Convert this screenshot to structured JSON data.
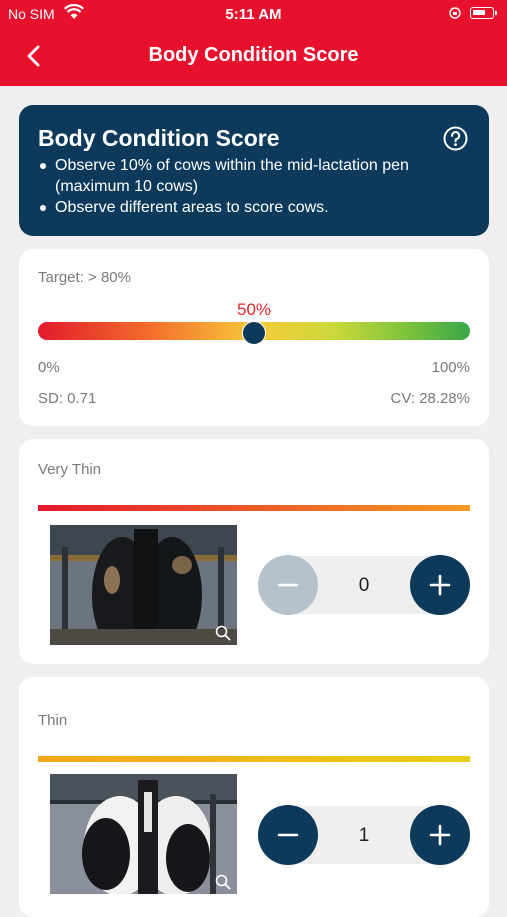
{
  "status": {
    "carrier": "No SIM",
    "time": "5:11 AM"
  },
  "nav": {
    "title": "Body Condition Score",
    "back_icon": "chevron-left-icon"
  },
  "info": {
    "title": "Body Condition Score",
    "bullets": [
      "Observe 10% of cows within the mid-lactation pen (maximum 10 cows)",
      "Observe different areas to score cows."
    ],
    "help_icon": "question-circle-icon"
  },
  "target": {
    "label": "Target: > 80%",
    "value_label": "50%",
    "value_fraction": 0.5,
    "min_label": "0%",
    "max_label": "100%",
    "sd": "SD: 0.71",
    "cv": "CV: 28.28%"
  },
  "scores": [
    {
      "label": "Very Thin",
      "count": "0",
      "minus_enabled": false,
      "stripe_from": "#e2192d",
      "stripe_to": "#f59b22"
    },
    {
      "label": "Thin",
      "count": "1",
      "minus_enabled": true,
      "stripe_from": "#f4a51d",
      "stripe_to": "#e8cf14"
    }
  ],
  "colors": {
    "brand_red": "#e8112d",
    "navy": "#0d3a5a",
    "disabled": "#b6c2cb"
  }
}
